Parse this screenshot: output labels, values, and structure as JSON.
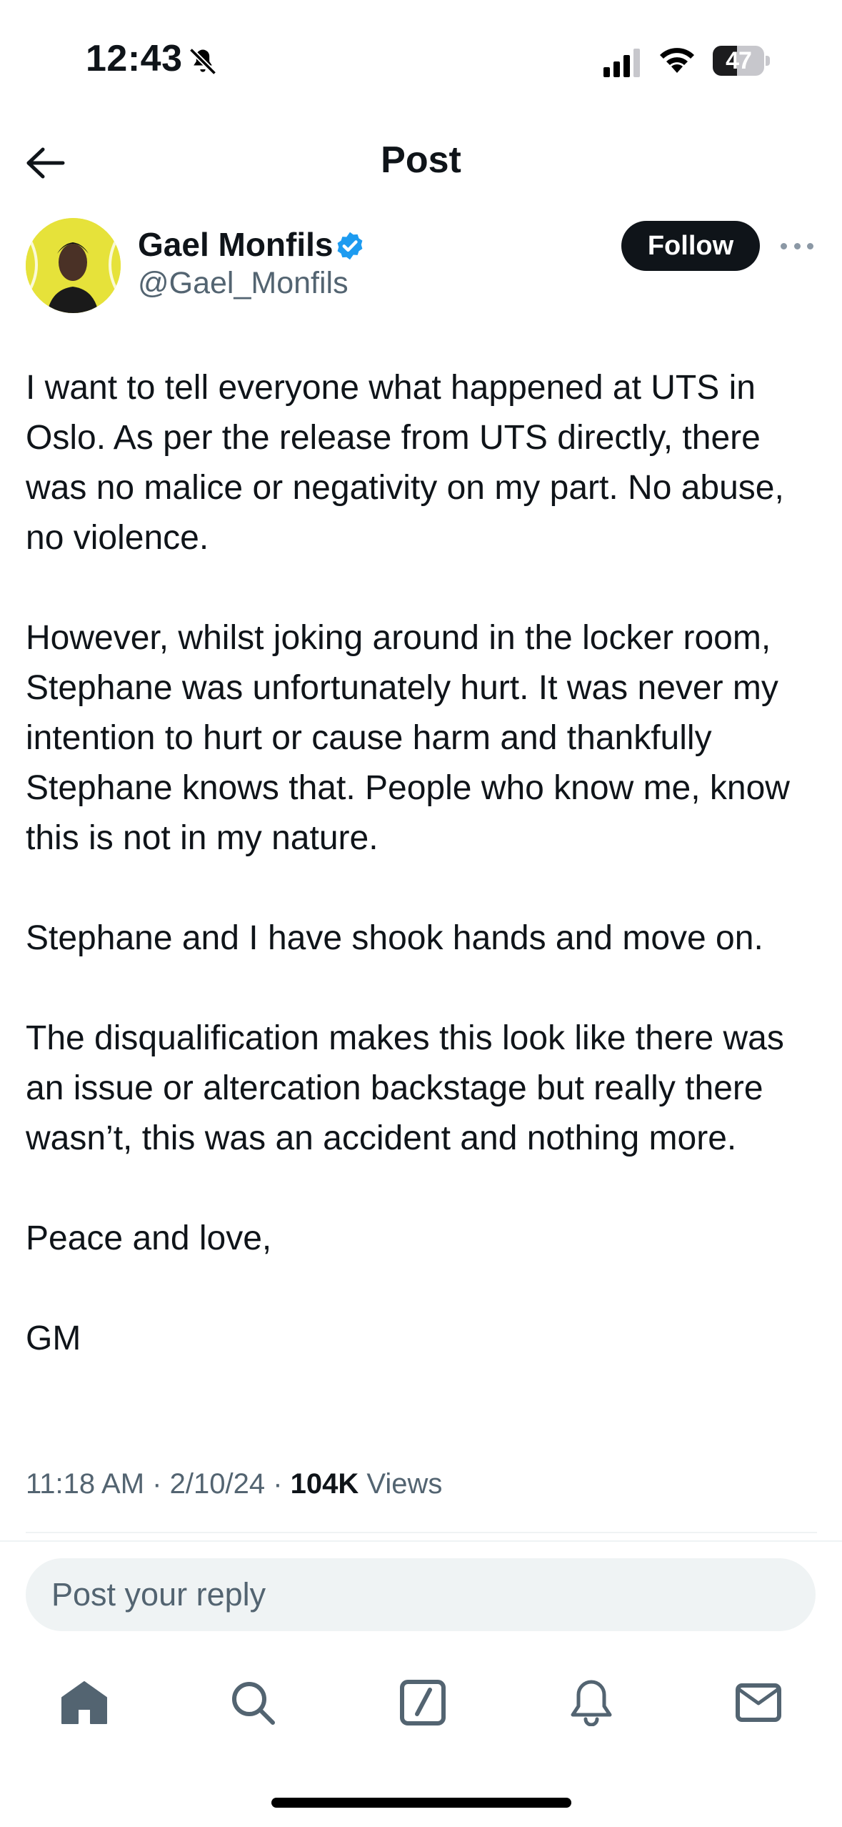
{
  "status_bar": {
    "time": "12:43",
    "battery_level": "47",
    "battery_fraction": 0.47
  },
  "header": {
    "title": "Post"
  },
  "author": {
    "name": "Gael Monfils",
    "handle": "@Gael_Monfils",
    "verified": true,
    "follow_label": "Follow"
  },
  "post": {
    "paragraphs": [
      "I want to tell everyone what happened at UTS in Oslo. As per the release from UTS directly, there was no malice or negativity on my part. No abuse, no violence.",
      "However, whilst joking around in the locker room, Stephane was unfortunately hurt. It was never my intention to hurt or cause harm and thankfully Stephane knows that. People who know me, know this is not in my nature.",
      "Stephane and I have shook hands and move on.",
      "The disqualification makes this look like there was an issue or altercation backstage but really there wasn’t, this was an accident and nothing more.",
      "Peace and love,",
      "GM"
    ],
    "time": "11:18 AM",
    "date": "2/10/24",
    "views_count": "104K",
    "views_label": "Views"
  },
  "reply": {
    "placeholder": "Post your reply"
  },
  "tab_bar": {
    "items": [
      "home-icon",
      "search-icon",
      "compose-icon",
      "notifications-icon",
      "messages-icon"
    ]
  },
  "colors": {
    "text": "#0f1419",
    "secondary": "#536471",
    "verified": "#1d9bf0",
    "input_bg": "#eff3f4"
  }
}
